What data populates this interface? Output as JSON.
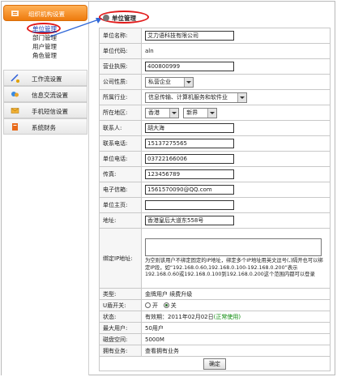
{
  "sidebar": {
    "top_label": "组织机构设置",
    "sub_items": [
      {
        "label": "单位管理",
        "active": true
      },
      {
        "label": "部门管理",
        "active": false
      },
      {
        "label": "用户管理",
        "active": false
      },
      {
        "label": "角色管理",
        "active": false
      }
    ],
    "sections": [
      {
        "label": "工作流设置",
        "icon": "workflow-icon"
      },
      {
        "label": "信息交流设置",
        "icon": "chat-icon"
      },
      {
        "label": "手机短信设置",
        "icon": "envelope-icon"
      },
      {
        "label": "系统财务",
        "icon": "ledger-icon"
      }
    ]
  },
  "main": {
    "title": "单位管理"
  },
  "form": {
    "name_label": "单位名称:",
    "name_value": "艾力语科技有限公司",
    "code_label": "单位代码:",
    "code_value": "aln",
    "license_label": "营业执照:",
    "license_value": "400800999",
    "nature_label": "公司性质:",
    "nature_value": "私营企业",
    "industry_label": "所属行业:",
    "industry_value": "信息传输、计算机服务和软件业",
    "region_label": "所在地区:",
    "region_value_1": "香港",
    "region_value_2": "新界",
    "contact_label": "联系人:",
    "contact_value": "胡大海",
    "phone_label": "联系电话:",
    "phone_value": "15137275565",
    "tel_label": "单位电话:",
    "tel_value": "03722166006",
    "fax_label": "传真:",
    "fax_value": "123456789",
    "email_label": "电子信箱:",
    "email_value": "1561570090@QQ.com",
    "homepage_label": "单位主页:",
    "homepage_value": "",
    "address_label": "地址:",
    "address_value": "香港皇后大道东558号",
    "ip_label": "绑定IP地址:",
    "ip_note": "为空则该用户不绑定固定的IP地址，绑定多个IP地址用英文逗号(,)隔开也可以绑定IP段，如“192.168.0.60,192.168.0.100-192.168.0.200”表示 192.168.0.60或192.168.0.100到192.168.0.200这个范围内都可以登录",
    "type_label": "类型:",
    "type_value": "金牌用户  续费升级",
    "shield_label": "U盾开关:",
    "shield_off": "开",
    "shield_on": "关",
    "status_label": "状态:",
    "status_value": "有效期：2011年02月02日",
    "status_tag": "(正常使用)",
    "max_users_label": "最大用户:",
    "max_users_value": "50用户",
    "disk_label": "磁盘空间:",
    "disk_value": "5000M",
    "business_label": "拥有业务:",
    "business_value": "查看拥有业务",
    "confirm_label": "确定"
  },
  "colors": {
    "accent": "#ee7a0d",
    "highlight": "#e21b1b",
    "link": "#1a3fb0",
    "status_ok": "#0a8a0a"
  }
}
